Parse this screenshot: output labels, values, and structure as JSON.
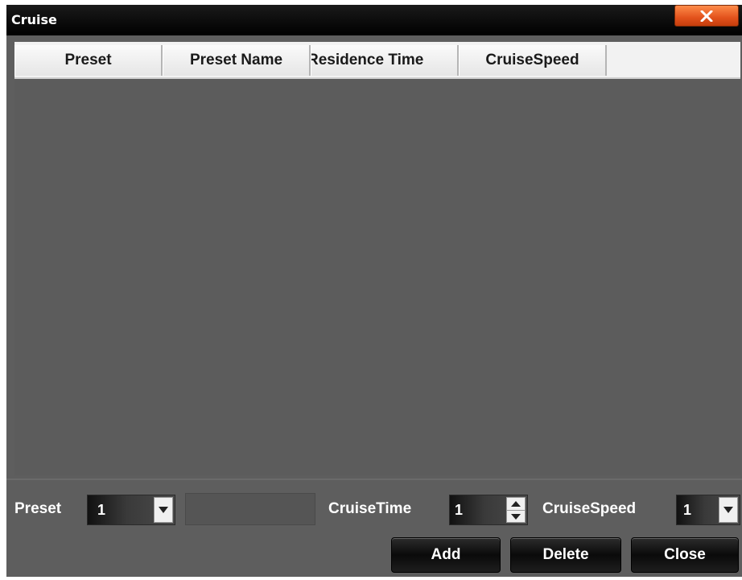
{
  "window": {
    "title": "Cruise",
    "close_icon": "close-x-icon"
  },
  "table": {
    "columns": [
      "Preset",
      "Preset Name",
      "Residence Time",
      "CruiseSpeed"
    ],
    "rows": []
  },
  "controls": {
    "preset_label": "Preset",
    "preset_value": "1",
    "preset_name_value": "",
    "cruise_time_label": "CruiseTime",
    "cruise_time_value": "1",
    "cruise_speed_label": "CruiseSpeed",
    "cruise_speed_value": "1"
  },
  "buttons": {
    "add": "Add",
    "delete": "Delete",
    "close": "Close"
  },
  "colors": {
    "panel": "#5e5e5e",
    "titlebar": "#000000",
    "close_accent": "#e2521c"
  }
}
